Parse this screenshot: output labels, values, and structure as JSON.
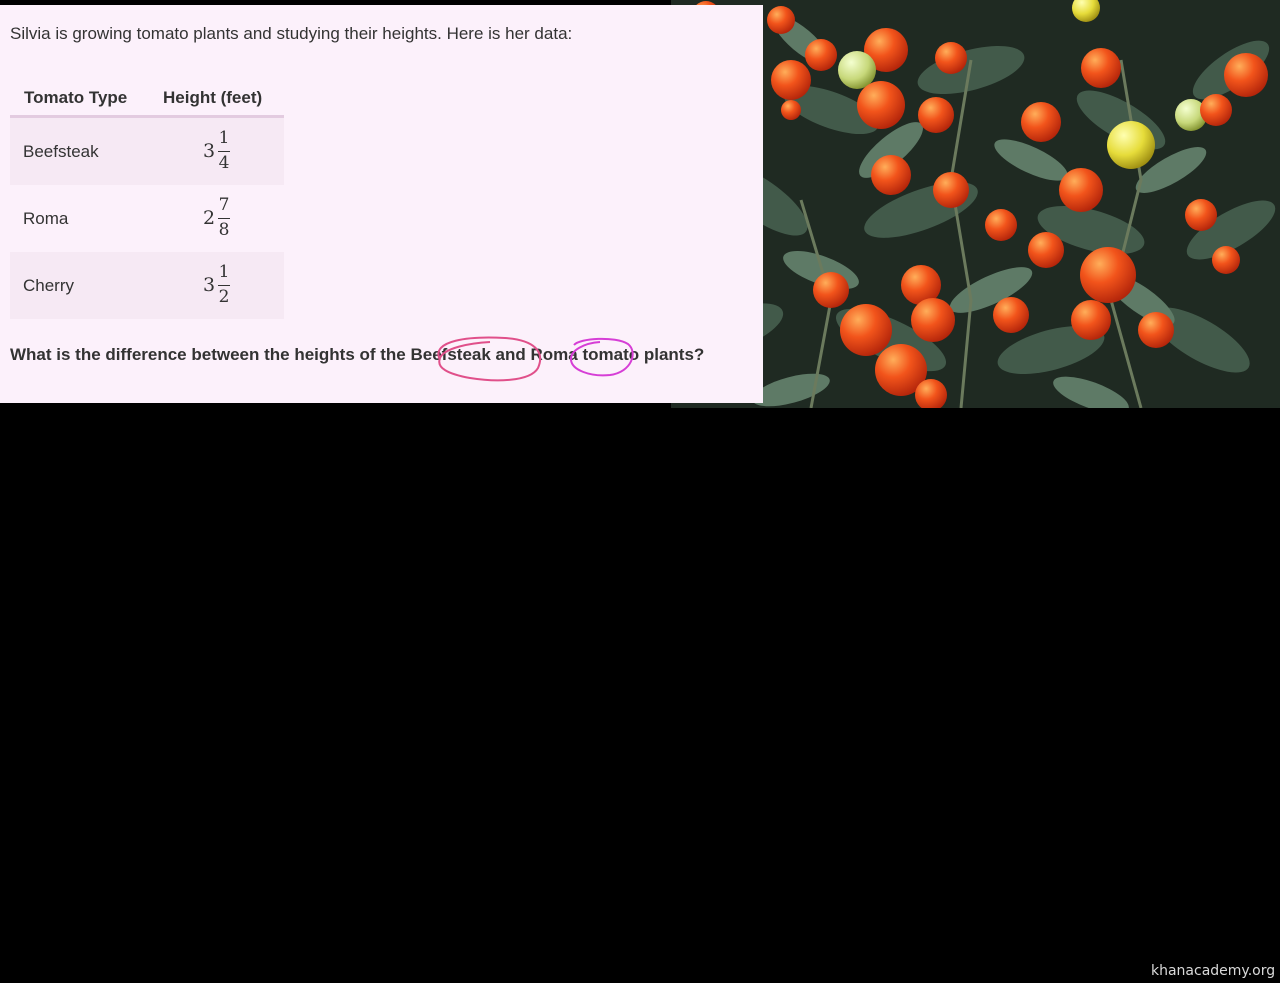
{
  "problem": {
    "intro": "Silvia is growing tomato plants and studying their heights. Here is her data:",
    "table": {
      "headers": [
        "Tomato Type",
        "Height (feet)"
      ],
      "rows": [
        {
          "type": "Beefsteak",
          "whole": "3",
          "numerator": "1",
          "denominator": "4"
        },
        {
          "type": "Roma",
          "whole": "2",
          "numerator": "7",
          "denominator": "8"
        },
        {
          "type": "Cherry",
          "whole": "3",
          "numerator": "1",
          "denominator": "2"
        }
      ]
    },
    "question": {
      "before": "What is the difference between the heights of the ",
      "term1": "Beefsteak",
      "middle": " and ",
      "term2": "Roma",
      "after": " tomato plants?"
    },
    "annotation_colors": {
      "circle1": "#e0508a",
      "circle2": "#d63ed6"
    }
  },
  "photo": {
    "icon": "tomato-plant-photo"
  },
  "watermark": "khanacademy.org"
}
